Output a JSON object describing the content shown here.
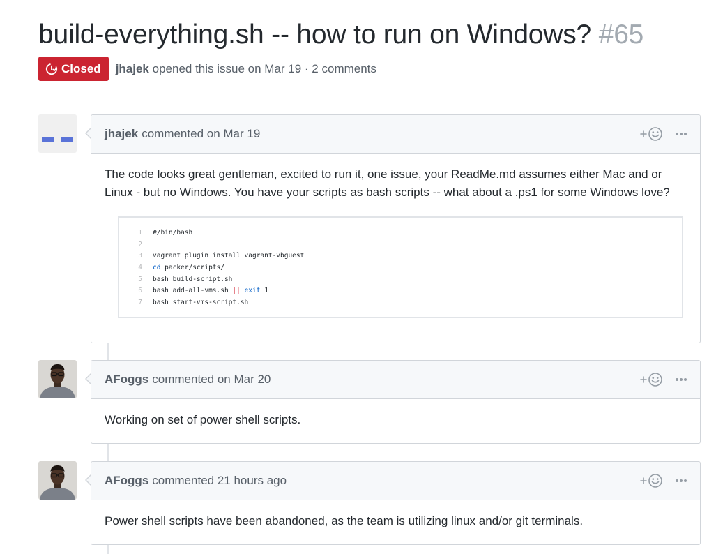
{
  "issue": {
    "title": "build-everything.sh -- how to run on Windows?",
    "number": "#65",
    "state": "Closed",
    "state_color": "#cb2431",
    "author": "jhajek",
    "opened_text": "opened this issue on Mar 19 · 2 comments"
  },
  "comments": [
    {
      "author": "jhajek",
      "time_text": "commented on Mar 19",
      "avatar": "identicon-avatar",
      "body": "The code looks great gentleman, excited to run it, one issue, your ReadMe.md assumes either Mac and or Linux - but no Windows. You have your scripts as bash scripts -- what about a .ps1 for some Windows love?",
      "code": {
        "lines": [
          {
            "num": "1",
            "parts": [
              {
                "text": "#/bin/bash",
                "kind": "plain"
              }
            ]
          },
          {
            "num": "2",
            "parts": []
          },
          {
            "num": "3",
            "parts": [
              {
                "text": "vagrant plugin install vagrant-vbguest",
                "kind": "plain"
              }
            ]
          },
          {
            "num": "4",
            "parts": [
              {
                "text": "cd",
                "kind": "keyword"
              },
              {
                "text": " packer/scripts/",
                "kind": "plain"
              }
            ]
          },
          {
            "num": "5",
            "parts": [
              {
                "text": "bash build-script.sh",
                "kind": "plain"
              }
            ]
          },
          {
            "num": "6",
            "parts": [
              {
                "text": "bash add-all-vms.sh ",
                "kind": "plain"
              },
              {
                "text": "||",
                "kind": "operator"
              },
              {
                "text": " ",
                "kind": "plain"
              },
              {
                "text": "exit",
                "kind": "keyword"
              },
              {
                "text": " 1",
                "kind": "plain"
              }
            ]
          },
          {
            "num": "7",
            "parts": [
              {
                "text": "bash start-vms-script.sh",
                "kind": "plain"
              }
            ]
          }
        ]
      }
    },
    {
      "author": "AFoggs",
      "time_text": "commented on Mar 20",
      "avatar": "person-avatar",
      "body": "Working on set of power shell scripts."
    },
    {
      "author": "AFoggs",
      "time_text": "commented 21 hours ago",
      "avatar": "person-avatar",
      "body": "Power shell scripts have been abandoned, as the team is utilizing linux and/or git terminals."
    }
  ],
  "icons": {
    "state": "issue-closed-icon",
    "reaction": "add-reaction-icon",
    "more": "kebab-horizontal-icon"
  },
  "colors": {
    "identicon": "#5a73d8",
    "header_bg": "#f6f8fa",
    "border": "#d1d5da"
  }
}
